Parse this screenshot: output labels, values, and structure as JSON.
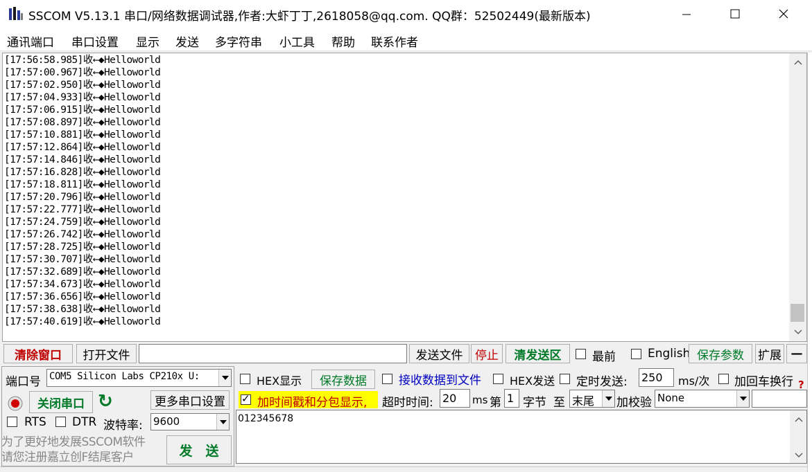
{
  "window": {
    "title": "SSCOM V5.13.1 串口/网络数据调试器,作者:大虾丁丁,2618058@qq.com. QQ群：52502449(最新版本)",
    "minimize_glyph": "—",
    "maximize_glyph": "☐",
    "close_glyph": "✕"
  },
  "menu": [
    "通讯端口",
    "串口设置",
    "显示",
    "发送",
    "多字符串",
    "小工具",
    "帮助",
    "联系作者"
  ],
  "receive": {
    "lines": [
      "[17:56:58.985]收←◆Helloworld",
      "[17:57:00.967]收←◆Helloworld",
      "[17:57:02.950]收←◆Helloworld",
      "[17:57:04.933]收←◆Helloworld",
      "[17:57:06.915]收←◆Helloworld",
      "[17:57:08.897]收←◆Helloworld",
      "[17:57:10.881]收←◆Helloworld",
      "[17:57:12.864]收←◆Helloworld",
      "[17:57:14.846]收←◆Helloworld",
      "[17:57:16.828]收←◆Helloworld",
      "[17:57:18.811]收←◆Helloworld",
      "[17:57:20.796]收←◆Helloworld",
      "[17:57:22.777]收←◆Helloworld",
      "[17:57:24.759]收←◆Helloworld",
      "[17:57:26.742]收←◆Helloworld",
      "[17:57:28.725]收←◆Helloworld",
      "[17:57:30.707]收←◆Helloworld",
      "[17:57:32.689]收←◆Helloworld",
      "[17:57:34.673]收←◆Helloworld",
      "[17:57:36.656]收←◆Helloworld",
      "[17:57:38.638]收←◆Helloworld",
      "[17:57:40.619]收←◆Helloworld"
    ],
    "scroll_up": "︿",
    "scroll_down": "﹀"
  },
  "toolbar": {
    "clear_window": "清除窗口",
    "open_file": "打开文件",
    "file_path": "",
    "send_file": "发送文件",
    "stop": "停止",
    "clear_send": "清发送区",
    "topmost": "最前",
    "english": "English",
    "save_params": "保存参数",
    "expand": "扩展",
    "collapse": "—"
  },
  "port": {
    "port_label": "端口号",
    "port_value": "COM5 Silicon Labs CP210x U:",
    "close_port": "关闭串口",
    "refresh_glyph": "↻",
    "more_settings": "更多串口设置",
    "rts": "RTS",
    "dtr": "DTR",
    "baud_label": "波特率:",
    "baud_value": "9600"
  },
  "options": {
    "hex_display": "HEX显示",
    "save_data": "保存数据",
    "recv_to_file": "接收数据到文件",
    "hex_send": "HEX发送",
    "timed_send": "定时发送:",
    "interval": "250",
    "interval_unit": "ms/次",
    "add_crlf": "加回车换行",
    "help_glyph": "?",
    "timestamp": "加时间戳和分包显示,",
    "timeout_label": "超时时间:",
    "timeout_value": "20",
    "timeout_unit": "ms",
    "byte_prefix": "第",
    "byte_index": "1",
    "byte_suffix": "字节",
    "to_label": "至",
    "to_value": "末尾",
    "checksum_label": "加校验",
    "checksum_value": "None",
    "checksum_extra": ""
  },
  "send": {
    "text": "012345678",
    "send_button": "发　送"
  },
  "promo": {
    "line1": "为了更好地发展SSCOM软件",
    "line2": "请您注册嘉立创F结尾客户"
  },
  "colors": {
    "red": "#c00000",
    "green": "#007a28",
    "highlight": "#ffff00"
  }
}
